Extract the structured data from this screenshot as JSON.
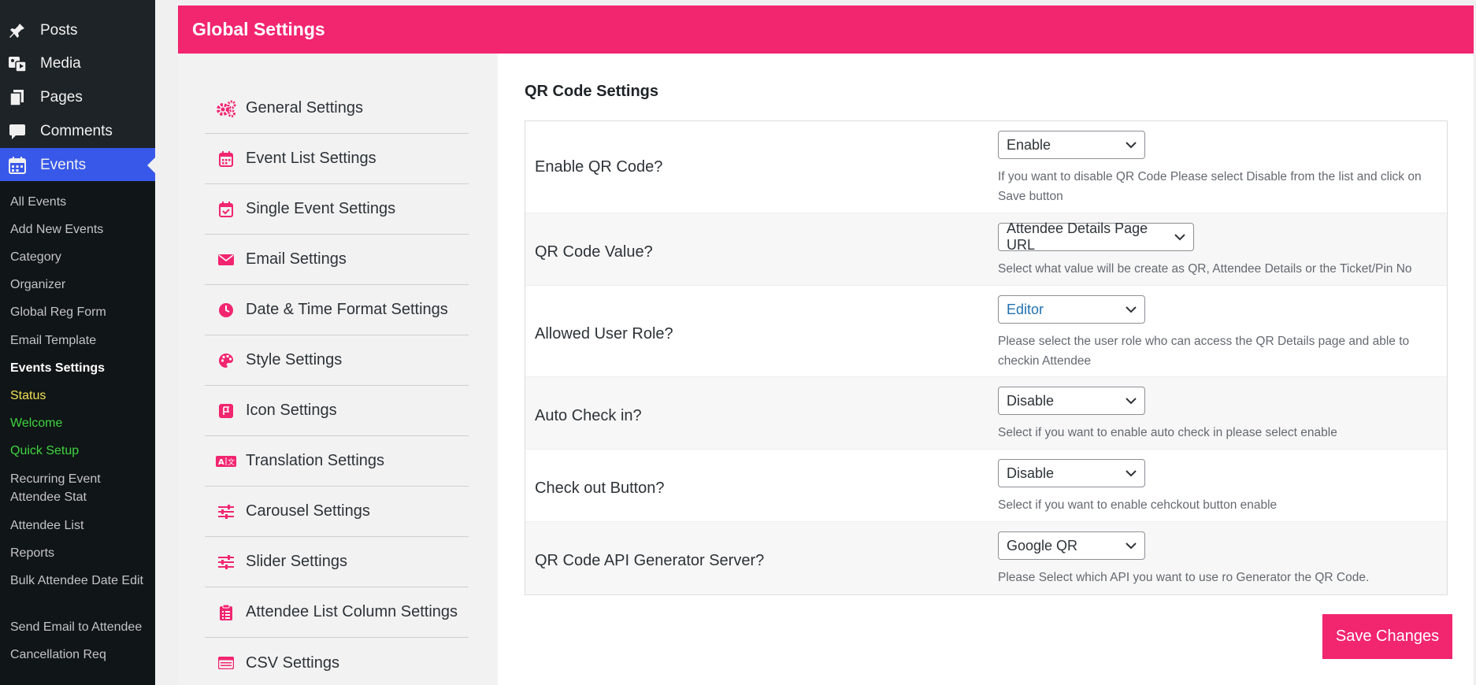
{
  "wp_menu": {
    "items": [
      {
        "label": "Posts",
        "icon": "pin-icon"
      },
      {
        "label": "Media",
        "icon": "media-icon"
      },
      {
        "label": "Pages",
        "icon": "pages-icon"
      },
      {
        "label": "Comments",
        "icon": "comment-icon"
      },
      {
        "label": "Events",
        "icon": "calendar-icon",
        "active": true
      }
    ],
    "submenu": [
      "All Events",
      "Add New Events",
      "Category",
      "Organizer",
      "Global Reg Form",
      "Email Template",
      "Events Settings",
      "Status",
      "Welcome",
      "Quick Setup",
      "Recurring Event Attendee Stat",
      "Attendee List",
      "Reports",
      "Bulk Attendee Date Edit",
      "Send Email to Attendee",
      "Cancellation Req"
    ]
  },
  "header": {
    "title": "Global Settings"
  },
  "settings_nav": [
    {
      "label": "General Settings",
      "icon": "gears-icon"
    },
    {
      "label": "Event List Settings",
      "icon": "calendar-icon"
    },
    {
      "label": "Single Event Settings",
      "icon": "calendar-check-icon"
    },
    {
      "label": "Email Settings",
      "icon": "envelope-icon"
    },
    {
      "label": "Date & Time Format Settings",
      "icon": "clock-icon"
    },
    {
      "label": "Style Settings",
      "icon": "palette-icon"
    },
    {
      "label": "Icon Settings",
      "icon": "flag-icon"
    },
    {
      "label": "Translation Settings",
      "icon": "language-icon"
    },
    {
      "label": "Carousel Settings",
      "icon": "sliders-icon"
    },
    {
      "label": "Slider Settings",
      "icon": "sliders-icon"
    },
    {
      "label": "Attendee List Column Settings",
      "icon": "clipboard-icon"
    },
    {
      "label": "CSV Settings",
      "icon": "csv-icon"
    }
  ],
  "content": {
    "section_title": "QR Code Settings",
    "rows": [
      {
        "label": "Enable QR Code?",
        "value": "Enable",
        "desc": "If you want to disable QR Code Please select Disable from the list and click on Save button"
      },
      {
        "label": "QR Code Value?",
        "value": "Attendee Details Page URL",
        "desc": "Select what value will be create as QR, Attendee Details or the Ticket/Pin No"
      },
      {
        "label": "Allowed User Role?",
        "value": "Editor",
        "desc": "Please select the user role who can access the QR Details page and able to checkin Attendee"
      },
      {
        "label": "Auto Check in?",
        "value": "Disable",
        "desc": "Select if you want to enable auto check in please select enable"
      },
      {
        "label": "Check out Button?",
        "value": "Disable",
        "desc": "Select if you want to enable cehckout button enable"
      },
      {
        "label": "QR Code API Generator Server?",
        "value": "Google QR",
        "desc": "Please Select which API you want to use ro Generator the QR Code."
      }
    ],
    "save_label": "Save Changes"
  },
  "colors": {
    "brand": "#f2256f",
    "active_menu": "#3858e9"
  }
}
